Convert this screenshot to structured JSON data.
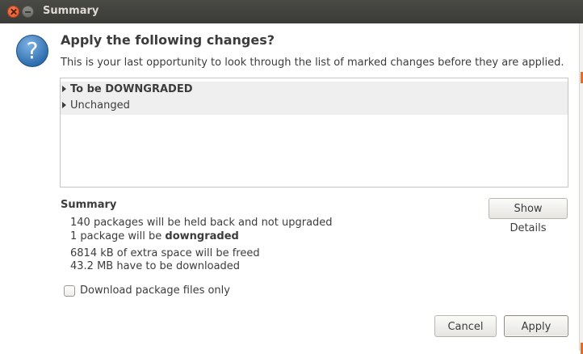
{
  "window": {
    "title": "Summary"
  },
  "dialog": {
    "icon": "question-icon",
    "heading": "Apply the following changes?",
    "subtext": "This is your last opportunity to look through the list of marked changes before they are applied."
  },
  "tree": {
    "items": [
      {
        "label": "To be DOWNGRADED",
        "bold": true,
        "expanded": false
      },
      {
        "label": "Unchanged",
        "bold": false,
        "expanded": false
      }
    ]
  },
  "summary": {
    "title": "Summary",
    "line1": "140 packages will be held back and not upgraded",
    "line2_prefix": "1 package will be ",
    "line2_bold": "downgraded",
    "line3": "6814 kB of extra space will be freed",
    "line4": "43.2 MB have to be downloaded",
    "show_details_label": "Show Details"
  },
  "options": {
    "download_only_label": "Download package files only",
    "download_only_checked": false
  },
  "buttons": {
    "cancel_label": "Cancel",
    "apply_label": "Apply"
  },
  "colors": {
    "titlebar": "#3f3f3c",
    "close_button": "#e5582a",
    "tree_row_bg": "#efefef"
  }
}
